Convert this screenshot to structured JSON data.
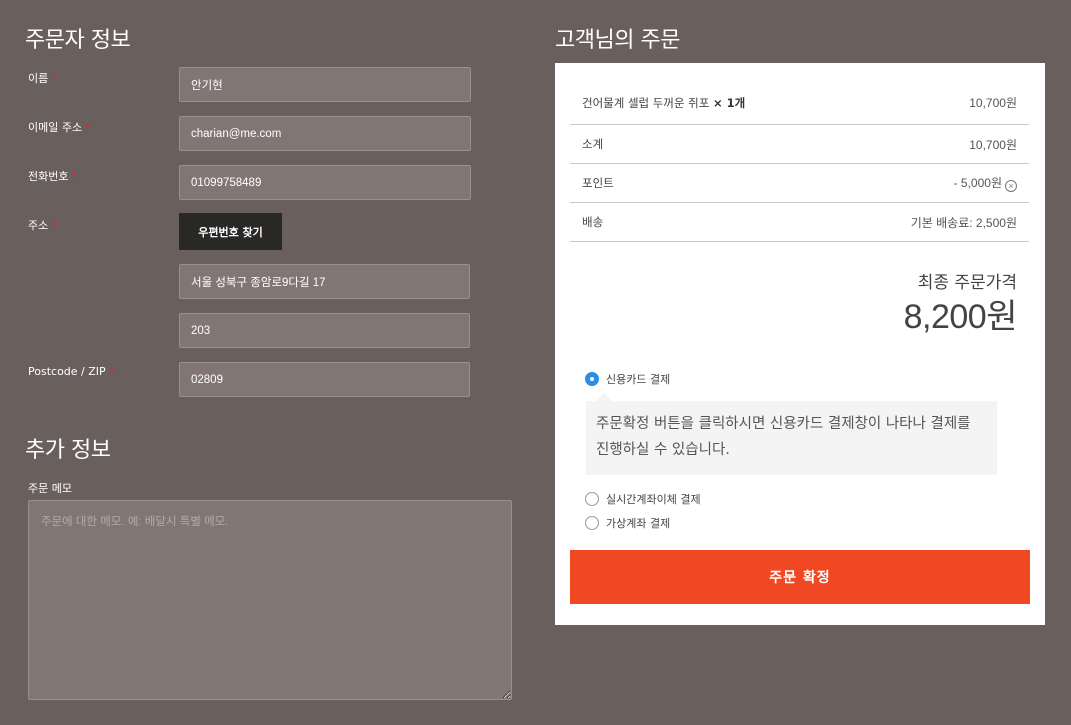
{
  "billing": {
    "title": "주문자 정보",
    "required_mark": "*",
    "name_label": "이름",
    "name_value": "안기현",
    "email_label": "이메일 주소",
    "email_value": "charian@me.com",
    "phone_label": "전화번호",
    "phone_value": "01099758489",
    "address_label": "주소",
    "postcode_button": "우편번호 찾기",
    "address1_value": "서울 성북구 종암로9다길 17",
    "address2_value": "203",
    "zip_label": "Postcode / ZIP",
    "zip_value": "02809"
  },
  "additional": {
    "title": "추가 정보",
    "memo_label": "주문 메모",
    "memo_placeholder": "주문에 대한 메모. 예: 배달시 특별 메모."
  },
  "order": {
    "title": "고객님의 주문",
    "item_name": "건어물계 셀럽 두꺼운 쥐포",
    "item_qty": "× 1개",
    "item_price": "10,700원",
    "subtotal_label": "소계",
    "subtotal_value": "10,700원",
    "points_label": "포인트",
    "points_value": "- 5,000원",
    "shipping_label": "배송",
    "shipping_value": "기본 배송료: 2,500원",
    "total_label": "최종 주문가격",
    "total_value": "8,200원",
    "payment_methods": [
      {
        "label": "신용카드 결제",
        "checked": true
      },
      {
        "label": "실시간계좌이체 결제",
        "checked": false
      },
      {
        "label": "가상계좌 결제",
        "checked": false
      }
    ],
    "payment_desc": "주문확정 버튼을 클릭하시면 신용카드 결제창이 나타나 결제를 진행하실 수 있습니다.",
    "place_order_button": "주문 확정"
  },
  "colors": {
    "background": "#695f5d",
    "input_bg": "#827675",
    "accent": "#ef4823",
    "required": "#e0262c",
    "radio_selected": "#2a8de6"
  }
}
